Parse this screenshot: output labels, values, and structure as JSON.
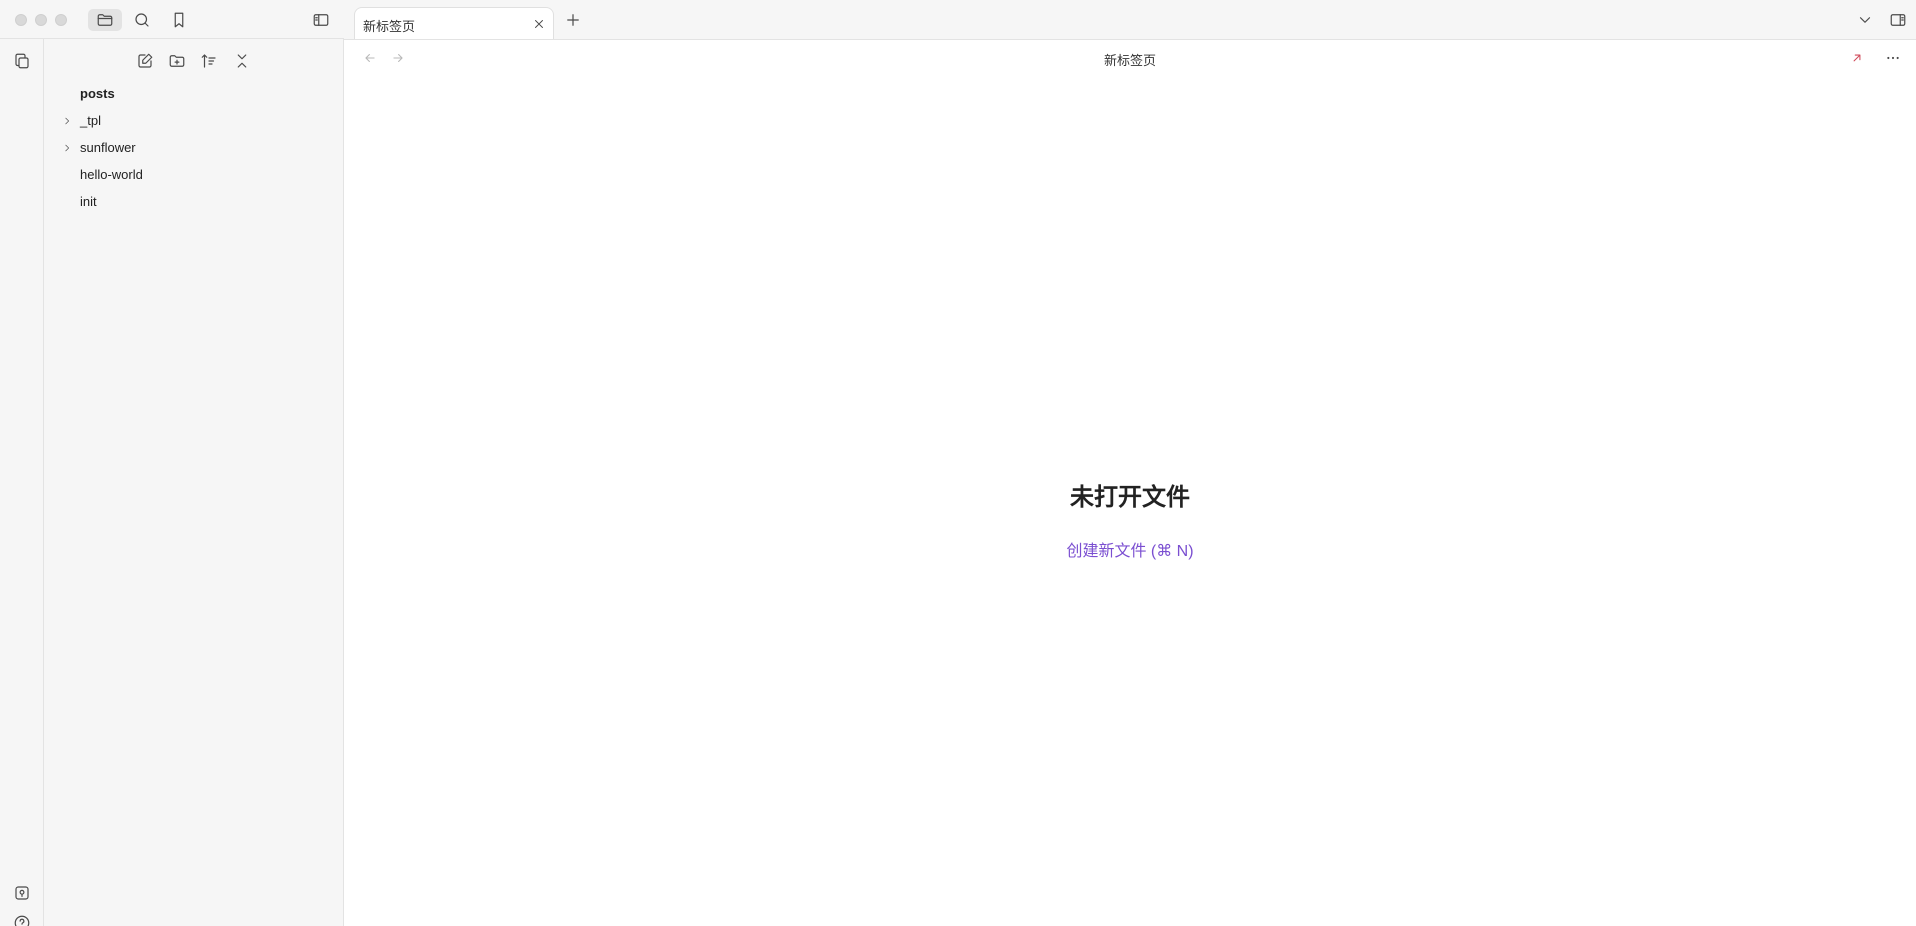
{
  "window": {
    "traffic_lights": [
      "close",
      "minimize",
      "zoom"
    ]
  },
  "titlebar": {
    "buttons": [
      "folder-icon",
      "search-icon",
      "bookmark-icon"
    ],
    "sidebar_toggle": "sidebar-left-icon",
    "right_buttons": [
      "chevron-down-icon",
      "sidebar-right-icon"
    ]
  },
  "tabs": [
    {
      "label": "新标签页",
      "active": true
    }
  ],
  "ribbon": {
    "top_icons": [
      "copy-icon"
    ],
    "bottom_icons": [
      "vault-icon",
      "help-icon"
    ]
  },
  "explorer": {
    "nav_icons": [
      "new-note-icon",
      "new-folder-icon",
      "sort-icon",
      "collapse-icon"
    ],
    "root": "posts",
    "items": [
      {
        "label": "_tpl",
        "type": "folder"
      },
      {
        "label": "sunflower",
        "type": "folder"
      },
      {
        "label": "hello-world",
        "type": "file"
      },
      {
        "label": "init",
        "type": "file"
      }
    ]
  },
  "main": {
    "view_title": "新标签页",
    "empty_title": "未打开文件",
    "create_link": "创建新文件 (⌘ N)",
    "accent_color": "#7b4fd1",
    "link_icon_color": "#d04a5a"
  }
}
